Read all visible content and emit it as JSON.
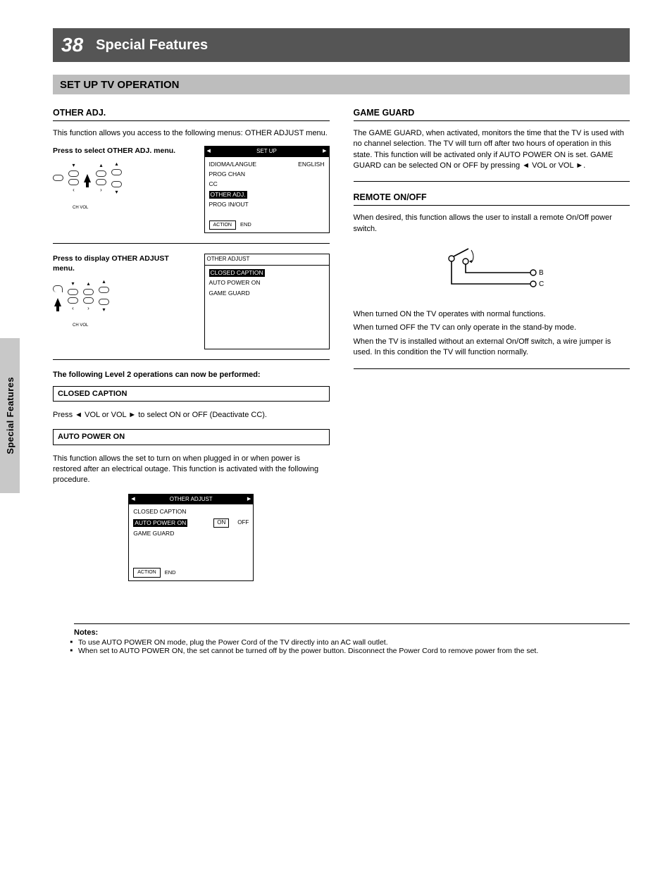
{
  "page": {
    "number": "38",
    "title": "Special Features",
    "section_bar": "SET UP TV OPERATION",
    "side_tab": "Special Features"
  },
  "col_left": {
    "heading": "OTHER ADJ.",
    "intro": "This function allows you access to the following menus: OTHER ADJUST menu.",
    "step4": {
      "label": "Press to select OTHER ADJ. menu.",
      "small": "CH VOL",
      "osd_title": "SET UP",
      "osd_items": [
        {
          "k": "IDIOMA/LANGUE",
          "v": "ENGLISH"
        },
        {
          "k": "PROG CHAN",
          "v": ""
        },
        {
          "k": "CC",
          "v": ""
        },
        {
          "k": "OTHER ADJ.",
          "v": "",
          "hl": true
        },
        {
          "k": "PROG IN/OUT",
          "v": ""
        }
      ],
      "osd_foot_action": "ACTION",
      "osd_foot_label": "END"
    },
    "step5": {
      "label": "Press to display OTHER ADJUST menu.",
      "small": "CH VOL",
      "osd_title": "OTHER ADJUST",
      "osd_items": [
        {
          "k": "CLOSED CAPTION",
          "v": "",
          "hl": true
        },
        {
          "k": "AUTO POWER ON",
          "v": ""
        },
        {
          "k": "GAME GUARD",
          "v": ""
        }
      ]
    },
    "l2": {
      "cc_head": "CLOSED CAPTION",
      "cc_text": "Press ◄ VOL or VOL ► to select ON or OFF (Deactivate CC).",
      "auto_head": "AUTO POWER ON",
      "auto_text": "This function allows the set to turn on when plugged in or when power is restored after an electrical outage. This function is activated with the following procedure.",
      "osd_title": "OTHER ADJUST",
      "osd_items": [
        {
          "k": "CLOSED CAPTION",
          "v": ""
        },
        {
          "k": "AUTO POWER ON",
          "v": "",
          "hl": true,
          "on": "ON",
          "off": "OFF"
        },
        {
          "k": "GAME GUARD",
          "v": ""
        }
      ],
      "osd_foot_action": "ACTION",
      "osd_foot_label": "END"
    }
  },
  "col_right": {
    "game_head": "GAME GUARD",
    "game_text": "The GAME GUARD, when activated, monitors the time that the TV is used with no channel selection. The TV will turn off after two hours of operation in this state. This function will be activated only if AUTO POWER ON is set. GAME GUARD can be selected ON or OFF by pressing ◄ VOL or VOL ►.",
    "remote_head": "REMOTE ON/OFF",
    "remote_intro": "When desired, this function allows the user to install a remote On/Off power switch.",
    "pin_b": "B",
    "pin_c": "C",
    "note_lines": [
      "When turned ON the TV operates with normal functions.",
      "When turned OFF the TV can only operate in the stand-by mode.",
      "When the TV is installed without an external On/Off switch, a wire jumper is used. In this condition the TV will function normally."
    ]
  },
  "notes": {
    "title": "Notes:",
    "items": [
      "To use AUTO POWER ON mode, plug the Power Cord of the TV directly into an AC wall outlet.",
      "When set to AUTO POWER ON, the set cannot be turned off by the power button. Disconnect the Power Cord to remove power from the set."
    ]
  }
}
